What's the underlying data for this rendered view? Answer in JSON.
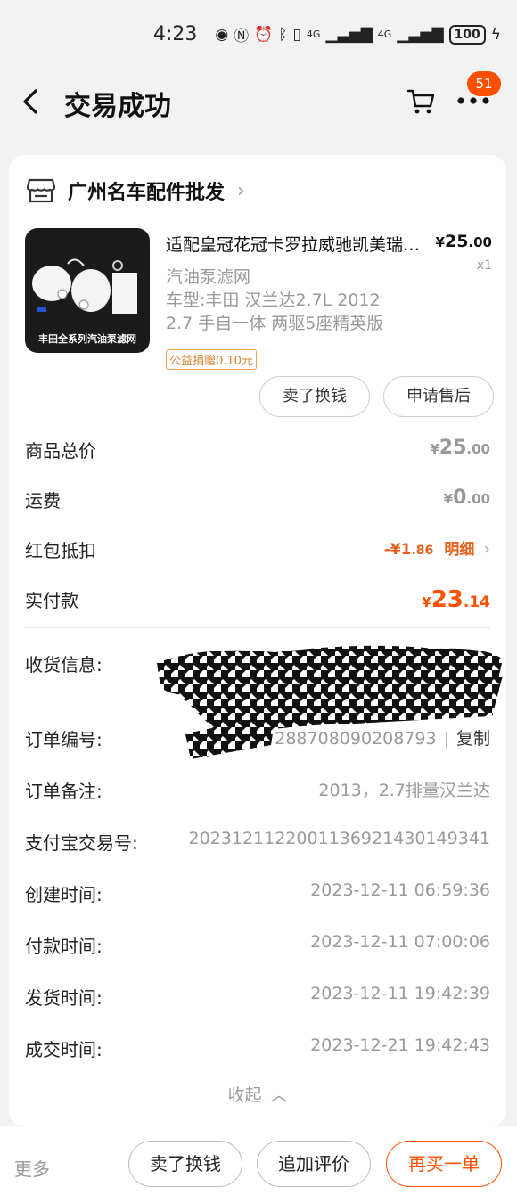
{
  "status_bar": {
    "time": "4:23",
    "network": "4G",
    "network2": "4G",
    "battery": "100"
  },
  "header": {
    "title": "交易成功",
    "badge_count": "51"
  },
  "shop": {
    "name": "广州名车配件批发"
  },
  "product": {
    "title": "适配皇冠花冠卡罗拉威驰凯美瑞雷凌汽油泵滤网",
    "price_symbol": "¥",
    "price_int": "25",
    "price_dec": ".00",
    "quantity": "x1",
    "spec1": "汽油泵滤网",
    "spec2": "车型:丰田 汉兰达2.7L 2012",
    "spec3": "2.7 手自一体 两驱5座精英版",
    "charity": "公益捐赠0.10元",
    "thumb_caption": "丰田全系列汽油泵滤网"
  },
  "actions": {
    "sell": "卖了换钱",
    "after_sale": "申请售后"
  },
  "summary": {
    "total_label": "商品总价",
    "total_int": "25",
    "total_dec": ".00",
    "shipping_label": "运费",
    "shipping_int": "0",
    "shipping_dec": ".00",
    "coupon_label": "红包抵扣",
    "coupon_prefix": "-¥",
    "coupon_int": "1",
    "coupon_dec": ".86",
    "coupon_detail": "明细",
    "paid_label": "实付款",
    "paid_int": "23",
    "paid_dec": ".14",
    "currency": "¥"
  },
  "info": {
    "address_label": "收货信息:",
    "order_no_label": "订单编号:",
    "order_no_value": "288708090208793",
    "copy_label": "复制",
    "note_label": "订单备注:",
    "note_value": "2013，2.7排量汉兰达",
    "alipay_label": "支付宝交易号:",
    "alipay_value": "2023121122001136921430149341",
    "created_label": "创建时间:",
    "created_value": "2023-12-11 06:59:36",
    "paid_label": "付款时间:",
    "paid_value": "2023-12-11 07:00:06",
    "shipped_label": "发货时间:",
    "shipped_value": "2023-12-11 19:42:39",
    "done_label": "成交时间:",
    "done_value": "2023-12-21 19:42:43",
    "collapse": "收起"
  },
  "bottom_bar": {
    "more": "更多",
    "sell": "卖了换钱",
    "review": "追加评价",
    "rebuy": "再买一单"
  },
  "colors": {
    "accent": "#ff5000",
    "discount": "#e6601b",
    "muted": "#999999"
  }
}
